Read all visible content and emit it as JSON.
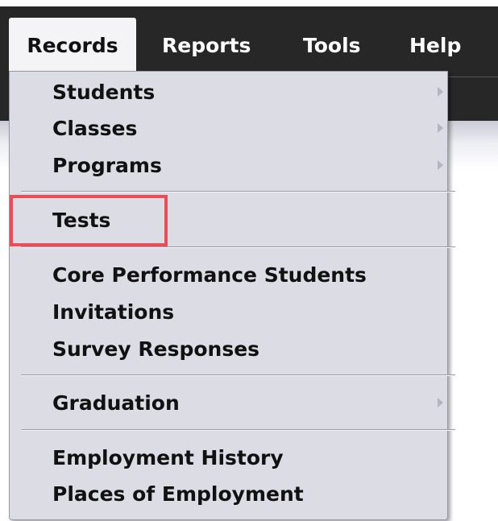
{
  "menubar": {
    "items": [
      {
        "label": "Records",
        "active": true
      },
      {
        "label": "Reports"
      },
      {
        "label": "Tools"
      },
      {
        "label": "Help"
      }
    ]
  },
  "dropdown": {
    "groups": [
      {
        "items": [
          {
            "label": "Students",
            "has_submenu": true
          },
          {
            "label": "Classes",
            "has_submenu": true
          },
          {
            "label": "Programs",
            "has_submenu": true
          }
        ]
      },
      {
        "items": [
          {
            "label": "Tests",
            "highlighted": true
          }
        ]
      },
      {
        "items": [
          {
            "label": "Core Performance Students"
          },
          {
            "label": "Invitations"
          },
          {
            "label": "Survey Responses"
          }
        ]
      },
      {
        "items": [
          {
            "label": "Graduation",
            "has_submenu": true
          }
        ]
      },
      {
        "items": [
          {
            "label": "Employment History"
          },
          {
            "label": "Places of Employment"
          }
        ]
      }
    ]
  },
  "colors": {
    "menubar_bg": "#272727",
    "dropdown_bg": "#dcdce4",
    "highlight_border": "#f04a55"
  },
  "icons": {
    "submenu": "chevron-right-icon"
  }
}
